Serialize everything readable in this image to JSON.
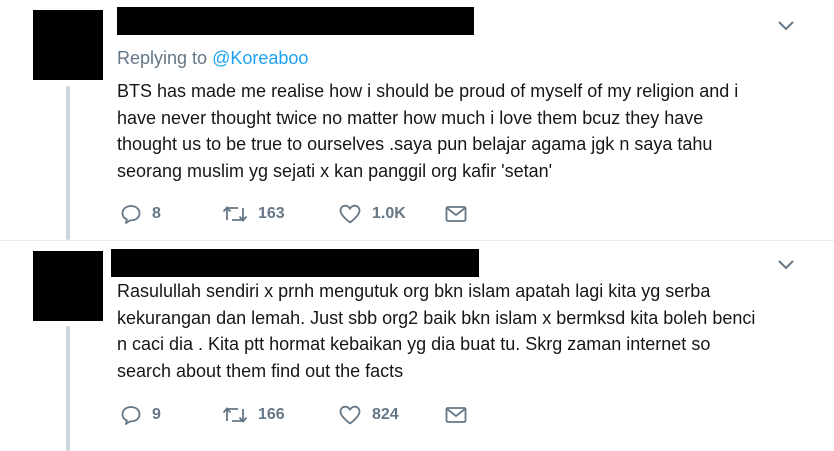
{
  "icons": {
    "reply": "reply-icon",
    "retweet": "retweet-icon",
    "like": "heart-icon",
    "dm": "envelope-icon",
    "more": "chevron-down-icon"
  },
  "colors": {
    "secondary_text": "#657786",
    "link": "#1da1f2",
    "thread_line": "#ccd6dd"
  },
  "tweets": [
    {
      "replying_prefix": "Replying to ",
      "replying_handle": "@Koreaboo",
      "text": "BTS has made me realise how i should be proud of myself of my religion and i\nhave never thought twice no matter how much i love them bcuz they have\nthought us to be true to ourselves .saya pun belajar agama jgk n saya tahu\nseorang muslim yg sejati x kan panggil org kafir 'setan'",
      "replies": "8",
      "retweets": "163",
      "likes": "1.0K"
    },
    {
      "text": "Rasulullah sendiri x prnh mengutuk org bkn islam apatah lagi kita yg serba\nkekurangan dan lemah. Just sbb org2 baik  bkn islam x bermksd kita boleh benci\nn caci dia . Kita ptt hormat kebaikan yg dia buat tu. Skrg zaman internet so\nsearch about them find out the facts",
      "replies": "9",
      "retweets": "166",
      "likes": "824"
    }
  ]
}
